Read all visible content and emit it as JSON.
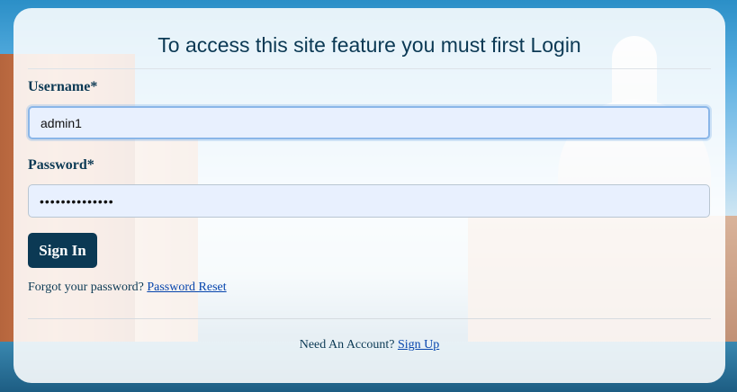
{
  "login": {
    "title": "To access this site feature you must first Login",
    "username_label": "Username*",
    "username_value": "admin1",
    "password_label": "Password*",
    "password_value": "••••••••••••••",
    "signin_label": "Sign In",
    "forgot_text": "Forgot your password?",
    "forgot_link": "Password Reset",
    "signup_text": "Need An Account?",
    "signup_link": "Sign Up"
  },
  "colors": {
    "primary": "#0b3954",
    "link": "#0645ad",
    "input_bg": "#e8f0fe"
  }
}
